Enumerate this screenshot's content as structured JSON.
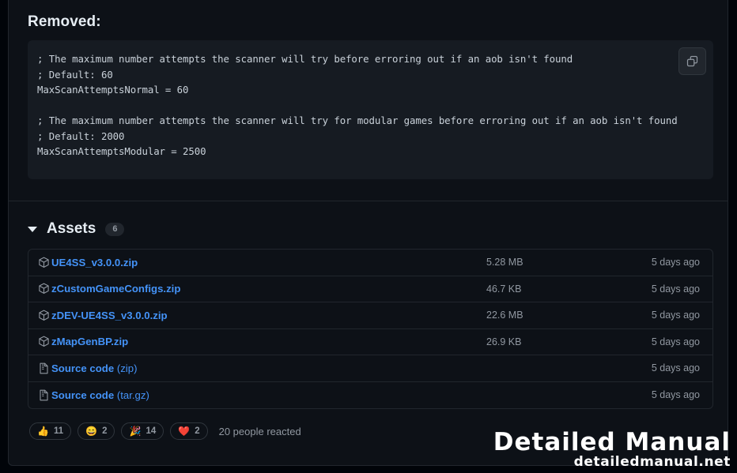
{
  "release": {
    "body_heading": "Removed:",
    "code_block": "; The maximum number attempts the scanner will try before erroring out if an aob isn't found\n; Default: 60\nMaxScanAttemptsNormal = 60\n\n; The maximum number attempts the scanner will try for modular games before erroring out if an aob isn't found\n; Default: 2000\nMaxScanAttemptsModular = 2500",
    "copy_button_label": "Copy"
  },
  "assets": {
    "title": "Assets",
    "count": "6",
    "rows": [
      {
        "name": "UE4SS_v3.0.0.zip",
        "suffix": "",
        "size": "5.28 MB",
        "date": "5 days ago",
        "icon": "package-icon"
      },
      {
        "name": "zCustomGameConfigs.zip",
        "suffix": "",
        "size": "46.7 KB",
        "date": "5 days ago",
        "icon": "package-icon"
      },
      {
        "name": "zDEV-UE4SS_v3.0.0.zip",
        "suffix": "",
        "size": "22.6 MB",
        "date": "5 days ago",
        "icon": "package-icon"
      },
      {
        "name": "zMapGenBP.zip",
        "suffix": "",
        "size": "26.9 KB",
        "date": "5 days ago",
        "icon": "package-icon"
      },
      {
        "name": "Source code",
        "suffix": " (zip)",
        "size": "",
        "date": "5 days ago",
        "icon": "file-zip-icon"
      },
      {
        "name": "Source code",
        "suffix": " (tar.gz)",
        "size": "",
        "date": "5 days ago",
        "icon": "file-zip-icon"
      }
    ]
  },
  "reactions": {
    "items": [
      {
        "emoji": "👍",
        "count": "11",
        "name": "thumbs-up"
      },
      {
        "emoji": "😄",
        "count": "2",
        "name": "laugh"
      },
      {
        "emoji": "🎉",
        "count": "14",
        "name": "hooray"
      },
      {
        "emoji": "❤️",
        "count": "2",
        "name": "heart"
      }
    ],
    "summary": "20 people reacted"
  },
  "watermark": {
    "main": "Detailed Manual",
    "sub": "detailedmanual.net"
  },
  "colors": {
    "page_bg": "#0d1117",
    "code_bg": "#161b22",
    "border": "#21262d",
    "link": "#4493f8",
    "muted": "#9198a1",
    "text": "#e6edf3"
  }
}
